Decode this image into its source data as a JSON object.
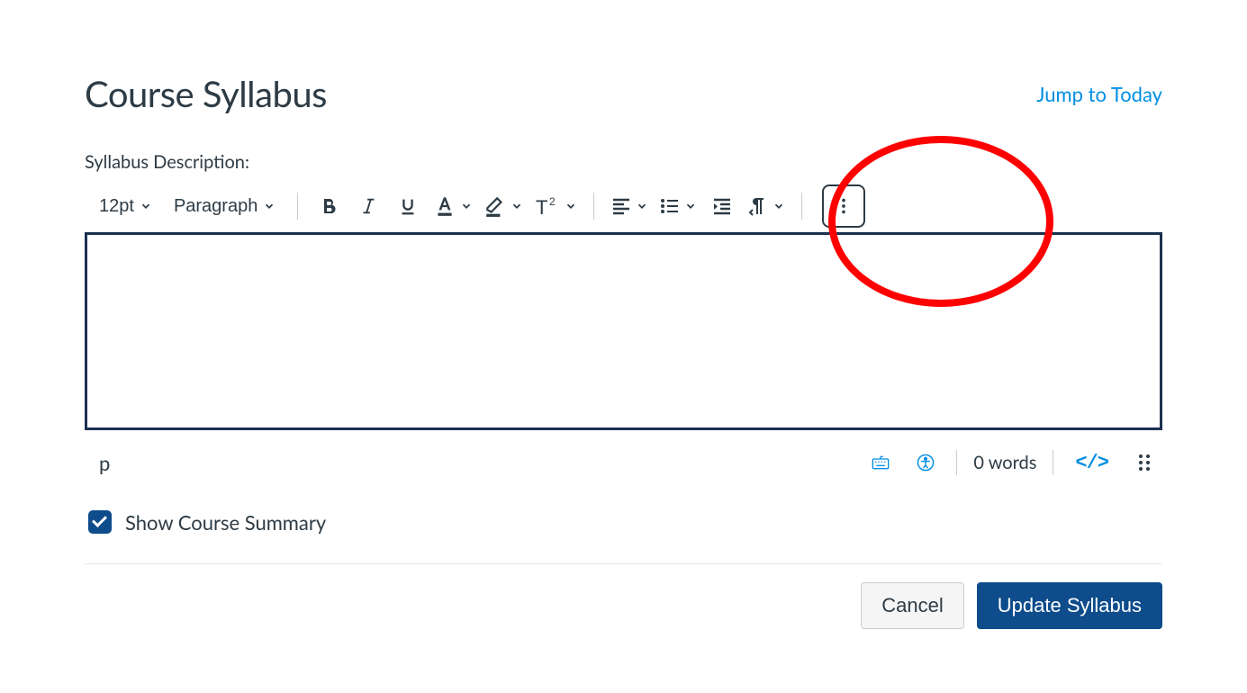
{
  "header": {
    "title": "Course Syllabus",
    "jump_link": "Jump to Today"
  },
  "editor": {
    "label": "Syllabus Description:",
    "font_size": "12pt",
    "block_format": "Paragraph",
    "value": ""
  },
  "status": {
    "path": "p",
    "word_count": "0 words",
    "html_symbol": "</>"
  },
  "show_summary": {
    "label": "Show Course Summary",
    "checked": true
  },
  "footer": {
    "cancel": "Cancel",
    "update": "Update Syllabus"
  },
  "colors": {
    "accent": "#008ee2",
    "primary": "#0e4c8b",
    "text": "#2d3b45",
    "annotation": "#ff0000"
  }
}
